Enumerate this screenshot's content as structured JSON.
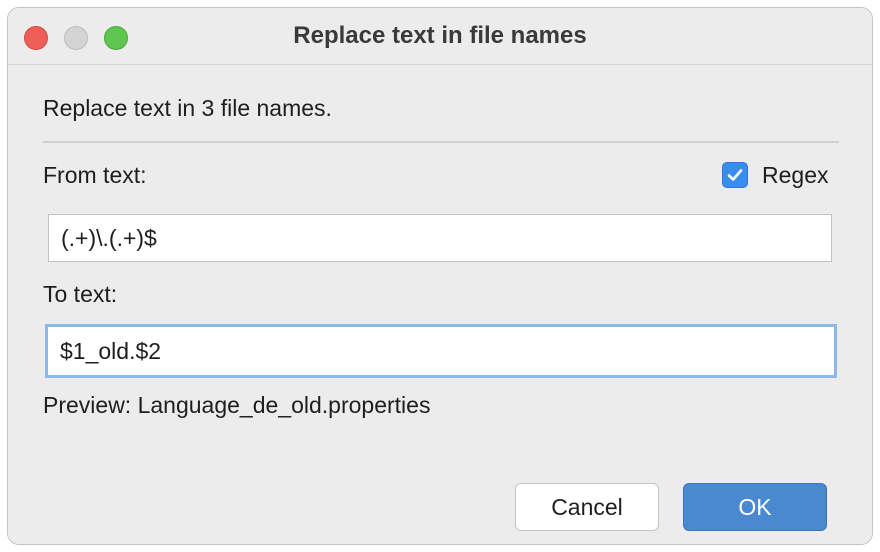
{
  "window": {
    "title": "Replace text in file names"
  },
  "dialog": {
    "description": "Replace text in 3 file names.",
    "from_label": "From text:",
    "from_value": "(.+)\\.(.+)$",
    "regex_label": "Regex",
    "regex_checked": true,
    "to_label": "To text:",
    "to_value": "$1_old.$2",
    "preview": "Preview: Language_de_old.properties"
  },
  "buttons": {
    "cancel": "Cancel",
    "ok": "OK"
  },
  "colors": {
    "accent": "#4a88cf",
    "checkbox": "#3a8df0",
    "focus_ring": "#8fb8ea",
    "close": "#ee5f58",
    "zoom": "#5fc551"
  }
}
